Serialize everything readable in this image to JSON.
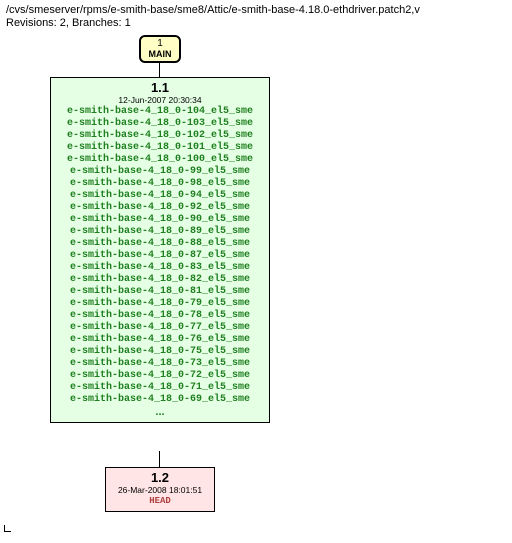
{
  "header": {
    "path": "/cvs/smeserver/rpms/e-smith-base/sme8/Attic/e-smith-base-4.18.0-ethdriver.patch2,v",
    "revline": "Revisions: 2, Branches: 1"
  },
  "branch": {
    "number": "1",
    "name": "MAIN"
  },
  "rev11": {
    "version": "1.1",
    "date": "12-Jun-2007 20:30:34",
    "tags": [
      "e-smith-base-4_18_0-104_el5_sme",
      "e-smith-base-4_18_0-103_el5_sme",
      "e-smith-base-4_18_0-102_el5_sme",
      "e-smith-base-4_18_0-101_el5_sme",
      "e-smith-base-4_18_0-100_el5_sme",
      "e-smith-base-4_18_0-99_el5_sme",
      "e-smith-base-4_18_0-98_el5_sme",
      "e-smith-base-4_18_0-94_el5_sme",
      "e-smith-base-4_18_0-92_el5_sme",
      "e-smith-base-4_18_0-90_el5_sme",
      "e-smith-base-4_18_0-89_el5_sme",
      "e-smith-base-4_18_0-88_el5_sme",
      "e-smith-base-4_18_0-87_el5_sme",
      "e-smith-base-4_18_0-83_el5_sme",
      "e-smith-base-4_18_0-82_el5_sme",
      "e-smith-base-4_18_0-81_el5_sme",
      "e-smith-base-4_18_0-79_el5_sme",
      "e-smith-base-4_18_0-78_el5_sme",
      "e-smith-base-4_18_0-77_el5_sme",
      "e-smith-base-4_18_0-76_el5_sme",
      "e-smith-base-4_18_0-75_el5_sme",
      "e-smith-base-4_18_0-73_el5_sme",
      "e-smith-base-4_18_0-72_el5_sme",
      "e-smith-base-4_18_0-71_el5_sme",
      "e-smith-base-4_18_0-69_el5_sme"
    ],
    "ellipsis": "..."
  },
  "rev12": {
    "version": "1.2",
    "date": "26-Mar-2008 18:01:51",
    "head": "HEAD"
  }
}
